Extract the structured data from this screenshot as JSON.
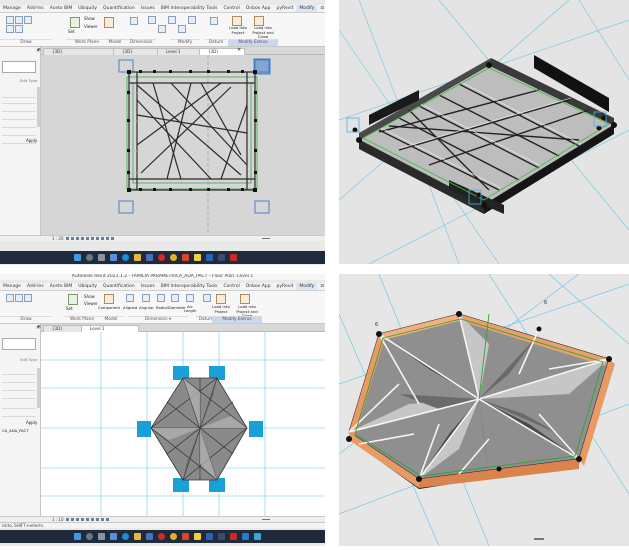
{
  "top_left": {
    "menu": [
      "Manage",
      "Add-Ins",
      "Aceto BIM",
      "Ubiquity",
      "Quantification",
      "Issues",
      "BIM Interoperability Tools",
      "Control",
      "Onbox App",
      "pyRevit",
      "Modify",
      "⊡ ▾"
    ],
    "ribbon_groups": [
      "Draw",
      "Work Plane",
      "Model",
      "Dimension",
      "Modify",
      "Datum",
      "Modify Extrus"
    ],
    "ribbon_buttons": {
      "show": "Show",
      "viewer": "Viewer",
      "set": "Set",
      "load_into_project": "Load into Project",
      "load_into_project_close": "Load into Project and Close"
    },
    "props": {
      "edit_type": "Edit Type",
      "apply": "Apply"
    },
    "tabs": [
      "{3D}",
      "{3D}",
      "Level 1",
      "{3D}"
    ],
    "scale": "1 : 20"
  },
  "bottom_left": {
    "title": "Autodesk Revit 2021.1.2 - FAMILIA PARAMETRICA_ADA_PACT - Floor Plan: Level 1",
    "menu": [
      "Manage",
      "Add-Ins",
      "Aceto BIM",
      "Ubiquity",
      "Quantification",
      "Issues",
      "BIM Interoperability Tools",
      "Control",
      "Onbox App",
      "pyRevit",
      "Modify",
      "⊡ ▾"
    ],
    "ribbon_groups": [
      "Draw",
      "Work Plane",
      "Model",
      "Dimension ▾",
      "Datum",
      "Modify Extrus"
    ],
    "ribbon_buttons": {
      "show": "Show",
      "viewer": "Viewer",
      "set": "Set",
      "component": "Component",
      "aligned": "Aligned",
      "angular": "Angular",
      "radial": "Radial",
      "diameter": "Diameter",
      "arc_length": "Arc Length",
      "load_into_project": "Load into Project",
      "load_into_project_close": "Load into Project and Close"
    },
    "props": {
      "edit_type": "Edit Type",
      "apply": "Apply",
      "family_name": "CA_ADA_PACT"
    },
    "tabs": [
      "{3D}",
      "Level 1"
    ],
    "scale": "1 : 10",
    "status": "ickto, SHIFT+selects."
  },
  "colors": {
    "blue_anchor": "#1aa0d8",
    "orange": "#e0925a",
    "taskbar": "#1f2a3a"
  },
  "icons": [
    "start-icon",
    "search-icon",
    "taskview-icon",
    "files-icon",
    "edge-icon",
    "store-icon",
    "chrome-icon",
    "revit-icon",
    "pdf-icon"
  ]
}
